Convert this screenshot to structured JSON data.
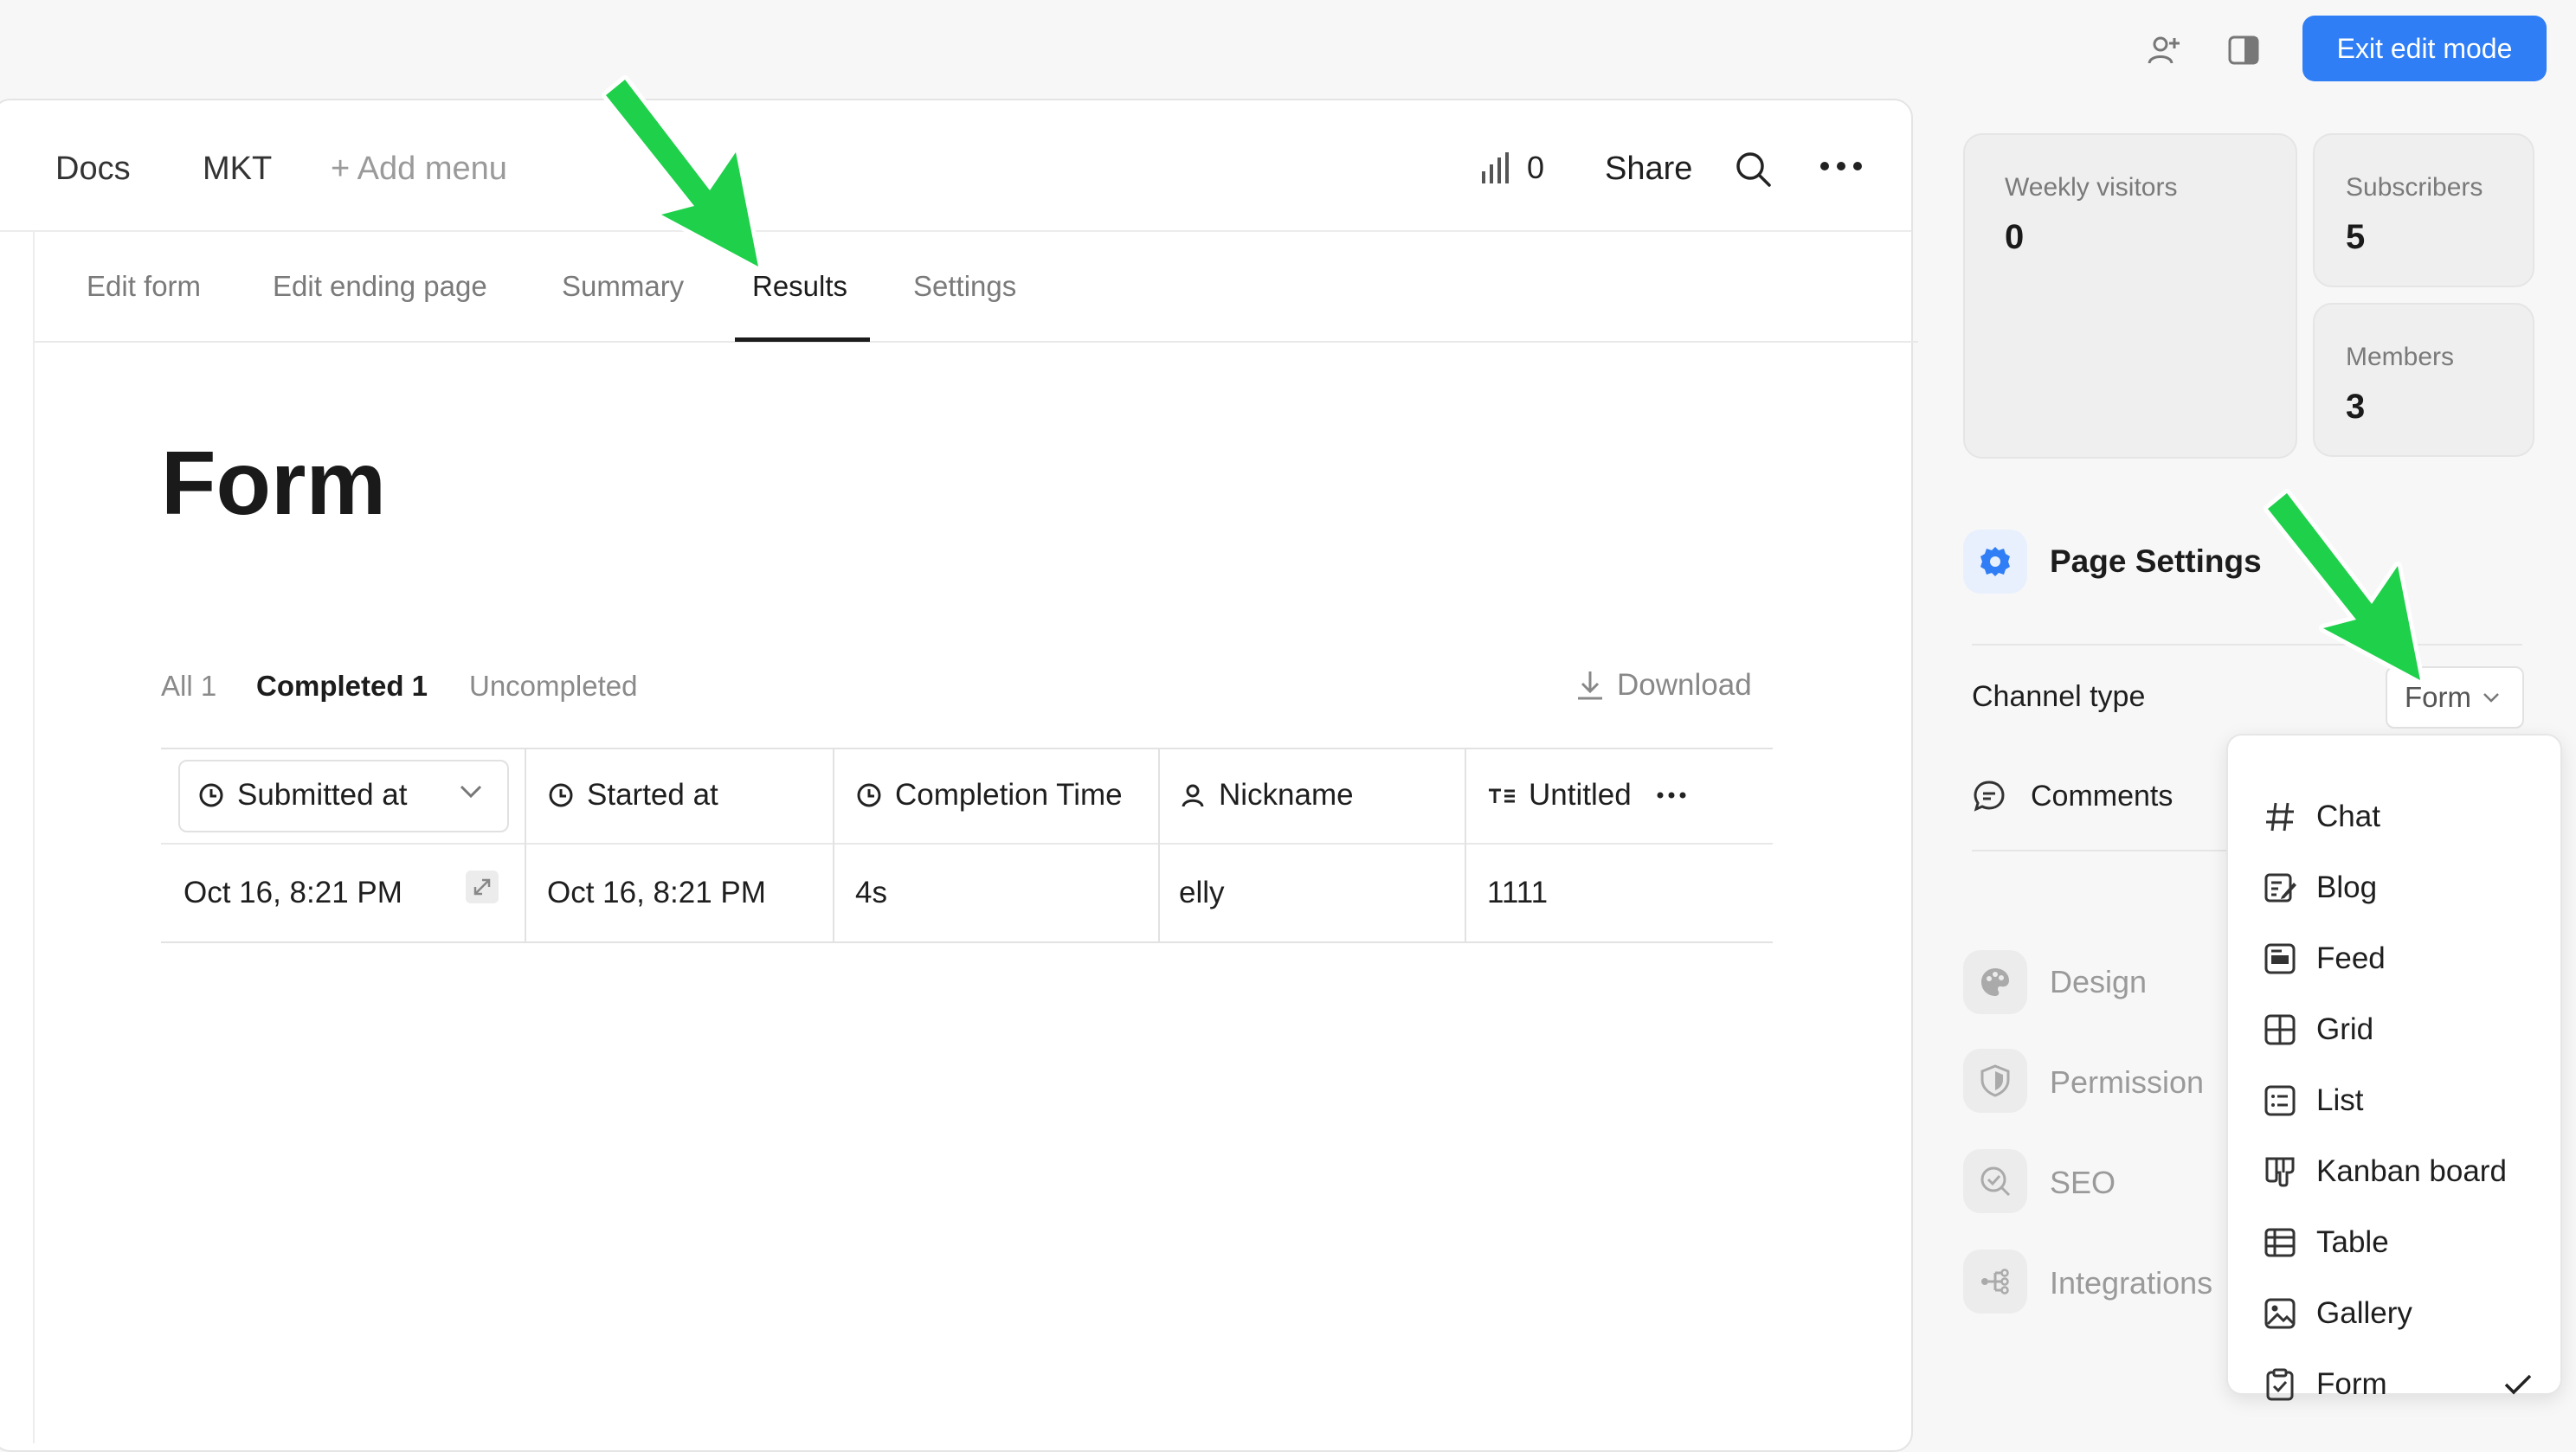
{
  "topbar": {
    "exit_label": "Exit edit mode"
  },
  "header": {
    "nav": [
      "Docs",
      "MKT"
    ],
    "add_menu": "+ Add menu",
    "views_count": "0",
    "share": "Share"
  },
  "tabs": [
    "Edit form",
    "Edit ending page",
    "Summary",
    "Results",
    "Settings"
  ],
  "page_title": "Form",
  "filters": {
    "all": "All 1",
    "completed": "Completed 1",
    "uncompleted": "Uncompleted",
    "download": "Download"
  },
  "table": {
    "columns": [
      "Submitted at",
      "Started at",
      "Completion Time",
      "Nickname",
      "Untitled"
    ],
    "rows": [
      [
        "Oct 16, 8:21 PM",
        "Oct 16, 8:21 PM",
        "4s",
        "elly",
        "1111"
      ]
    ]
  },
  "stats": {
    "weekly_visitors_label": "Weekly visitors",
    "weekly_visitors_value": "0",
    "subscribers_label": "Subscribers",
    "subscribers_value": "5",
    "members_label": "Members",
    "members_value": "3"
  },
  "page_settings": {
    "title": "Page Settings",
    "channel_type_label": "Channel type",
    "channel_type_value": "Form",
    "comments_label": "Comments"
  },
  "sidebar_sections": [
    "Design",
    "Permission",
    "SEO",
    "Integrations"
  ],
  "channel_types": [
    "Chat",
    "Blog",
    "Feed",
    "Grid",
    "List",
    "Kanban board",
    "Table",
    "Gallery",
    "Form"
  ],
  "selected_channel_type": "Form",
  "colors": {
    "accent": "#2f7ef6",
    "annotation_arrow": "#1fd04b"
  }
}
